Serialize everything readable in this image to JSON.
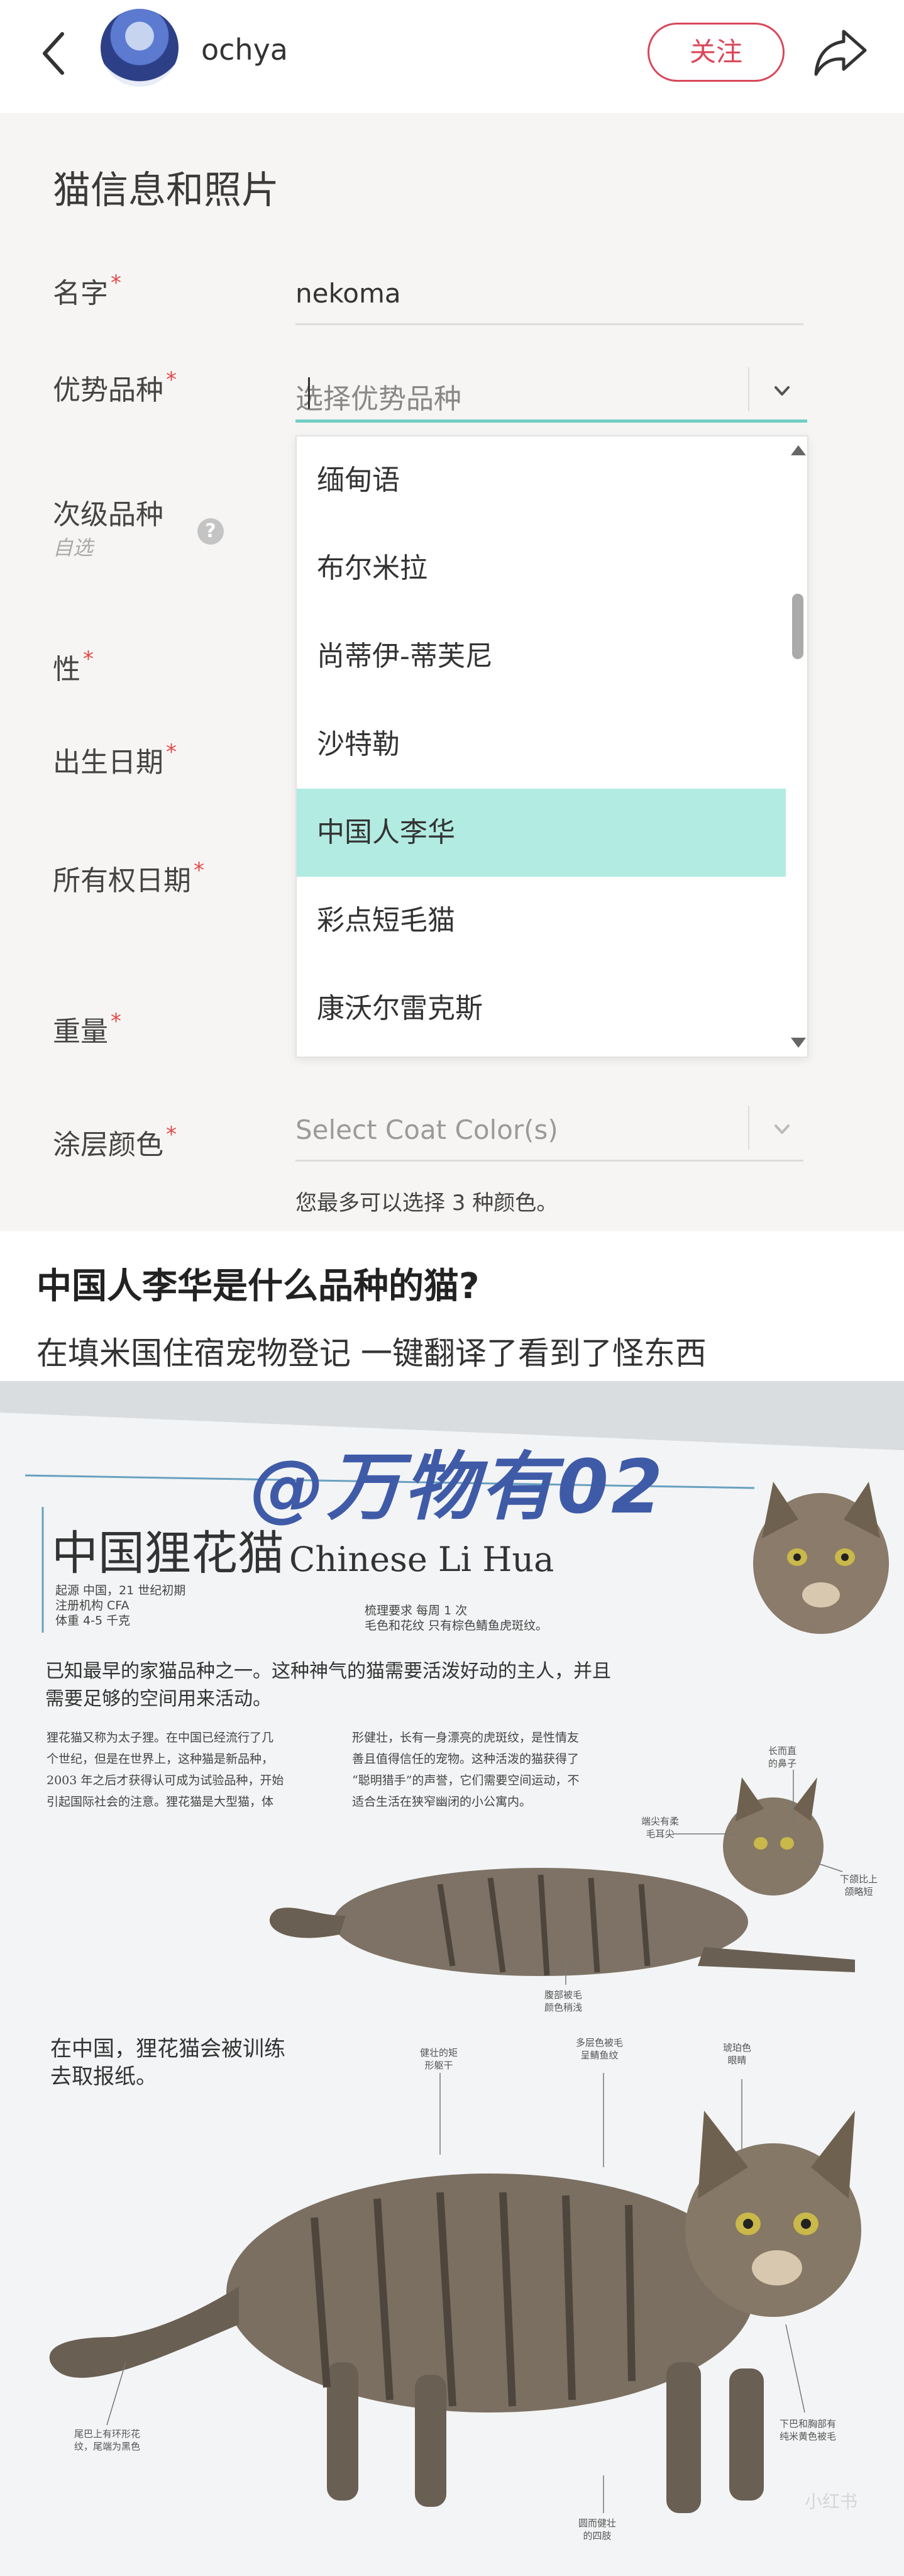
{
  "header": {
    "username": "ochya",
    "follow_label": "关注"
  },
  "form": {
    "title": "猫信息和照片",
    "fields": {
      "name_label": "名字",
      "name_value": "nekoma",
      "primary_breed_label": "优势品种",
      "primary_breed_placeholder": "选择优势品种",
      "secondary_breed_label": "次级品种",
      "secondary_breed_optional": "自选",
      "sex_label": "性",
      "birth_label": "出生日期",
      "ownership_label": "所有权日期",
      "weight_label": "重量",
      "coat_label": "涂层颜色",
      "coat_placeholder": "Select Coat Color(s)",
      "coat_hint": "您最多可以选择 3 种颜色。",
      "required_mark": "*",
      "help_glyph": "?"
    },
    "dropdown_options": [
      {
        "label": "缅甸语",
        "selected": false
      },
      {
        "label": "布尔米拉",
        "selected": false
      },
      {
        "label": "尚蒂伊-蒂芙尼",
        "selected": false
      },
      {
        "label": "沙特勒",
        "selected": false
      },
      {
        "label": "中国人李华",
        "selected": true
      },
      {
        "label": "彩点短毛猫",
        "selected": false
      },
      {
        "label": "康沃尔雷克斯",
        "selected": false
      }
    ]
  },
  "post": {
    "title": "中国人李华是什么品种的猫?",
    "body": "在填米国住宿宠物登记 一键翻译了看到了怪东西"
  },
  "book": {
    "watermark": "@万物有02",
    "title_cn": "中国狸花猫",
    "title_en": "Chinese Li Hua",
    "meta_left": [
      "起源 中国，21 世纪初期",
      "注册机构 CFA",
      "体重 4-5 千克"
    ],
    "meta_right": [
      "梳理要求 每周 1 次",
      "毛色和花纹 只有棕色鲭鱼虎斑纹。"
    ],
    "intro": "已知最早的家猫品种之一。这种神气的猫需要活泼好动的主人，并且需要足够的空间用来活动。",
    "col1": [
      "狸花猫又称为太子狸。在中国已经流行了几",
      "个世纪，但是在世界上，这种猫是新品种，",
      "2003 年之后才获得认可成为试验品种，开始",
      "引起国际社会的注意。狸花猫是大型猫，体"
    ],
    "col2": [
      "形健壮，长有一身漂亮的虎斑纹，是性情友",
      "善且值得信任的宠物。这种活泼的猫获得了",
      "“聪明猎手”的声誉，它们需要空间运动，不",
      "适合生活在狭窄幽闭的小公寓内。"
    ],
    "callouts": {
      "nose": "长而直\n的鼻子",
      "ears": "端尖有柔\n毛耳尖",
      "chin": "下颌比上\n颌略短",
      "belly": "腹部被毛\n颜色稍浅",
      "body": "健壮的矩\n形躯干",
      "coat": "多层色被毛\n呈鲭鱼纹",
      "eyes": "琥珀色\n眼睛",
      "tail": "尾巴上有环形花\n纹，尾端为黑色",
      "legs": "圆而健壮\n的四肢",
      "paws": "下巴和胸部有\n纯米黄色被毛"
    },
    "note": [
      "在中国，狸花猫会被训练",
      "去取报纸。"
    ],
    "corner_mark": "小红书"
  }
}
